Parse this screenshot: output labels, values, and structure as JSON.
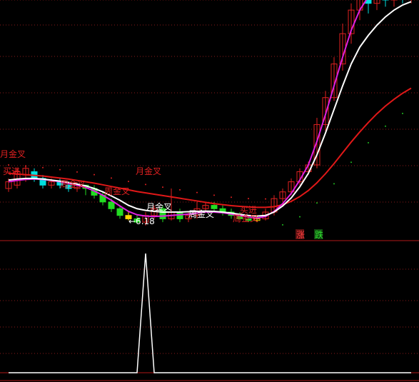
{
  "chart_data": {
    "type": "candlestick",
    "colors": {
      "background": "#000000",
      "grid": "#8a1a1a",
      "panel_border": "#b01818",
      "up": "#e02020",
      "down": "#00e0e0",
      "green_down": "#22dd22",
      "yellow": "#ffd700",
      "ma_white": "#ffffff",
      "ma_magenta": "#e020e0",
      "ma_red": "#e01818",
      "sar_dots": "#20c020",
      "sar_dots_red": "#e02020",
      "signal_red": "#e02020",
      "signal_white": "#ffffff",
      "price_label": "#ffffff"
    },
    "price_panel": {
      "ylim": [
        5.5,
        12.5
      ],
      "candles": [
        [
          6.9,
          7.1,
          6.8,
          7.2
        ],
        [
          7.0,
          7.4,
          6.9,
          7.5
        ],
        [
          7.3,
          7.5,
          7.1,
          7.6
        ],
        [
          7.4,
          7.2,
          7.1,
          7.5
        ],
        [
          7.2,
          7.0,
          6.9,
          7.3
        ],
        [
          7.0,
          7.1,
          6.9,
          7.2
        ],
        [
          7.1,
          7.0,
          6.9,
          7.2
        ],
        [
          7.0,
          6.9,
          6.8,
          7.1
        ],
        [
          6.9,
          7.0,
          6.8,
          7.1
        ],
        [
          7.0,
          6.9,
          6.7,
          7.0
        ],
        [
          6.9,
          6.7,
          6.6,
          7.0
        ],
        [
          6.7,
          6.5,
          6.4,
          6.8
        ],
        [
          6.5,
          6.3,
          6.2,
          6.6
        ],
        [
          6.3,
          6.1,
          6.0,
          6.4
        ],
        [
          6.1,
          6.0,
          5.95,
          6.2
        ],
        [
          6.0,
          5.9,
          5.85,
          6.1
        ],
        [
          5.9,
          6.1,
          5.8,
          6.2
        ],
        [
          6.1,
          6.3,
          6.0,
          6.4
        ],
        [
          6.3,
          6.0,
          5.9,
          6.4
        ],
        [
          6.0,
          6.2,
          5.95,
          6.9
        ],
        [
          6.2,
          6.0,
          5.9,
          6.3
        ],
        [
          6.0,
          6.1,
          5.9,
          6.2
        ],
        [
          6.1,
          6.3,
          6.0,
          6.5
        ],
        [
          6.3,
          6.4,
          6.2,
          6.5
        ],
        [
          6.4,
          6.3,
          6.2,
          6.5
        ],
        [
          6.3,
          6.2,
          6.1,
          6.4
        ],
        [
          6.2,
          6.1,
          6.0,
          6.3
        ],
        [
          6.1,
          6.0,
          5.95,
          6.2
        ],
        [
          6.0,
          5.95,
          5.9,
          6.1
        ],
        [
          5.95,
          6.0,
          5.9,
          6.1
        ],
        [
          6.0,
          6.2,
          5.95,
          6.3
        ],
        [
          6.2,
          6.6,
          6.1,
          6.7
        ],
        [
          6.6,
          6.8,
          6.5,
          6.9
        ],
        [
          6.8,
          7.1,
          6.7,
          7.2
        ],
        [
          7.1,
          7.4,
          7.0,
          7.5
        ],
        [
          7.4,
          7.6,
          7.3,
          7.7
        ],
        [
          7.6,
          8.8,
          7.5,
          9.0
        ],
        [
          8.8,
          9.6,
          8.6,
          9.8
        ],
        [
          9.6,
          10.6,
          9.5,
          10.8
        ],
        [
          10.6,
          11.5,
          10.4,
          11.8
        ],
        [
          11.5,
          12.2,
          11.2,
          12.4
        ],
        [
          12.2,
          12.6,
          11.9,
          12.8
        ],
        [
          12.6,
          12.4,
          12.1,
          12.9
        ],
        [
          12.4,
          12.7,
          12.2,
          12.9
        ],
        [
          12.7,
          12.5,
          12.3,
          12.8
        ],
        [
          12.5,
          12.8,
          12.3,
          12.9
        ],
        [
          12.8,
          12.6,
          12.4,
          12.9
        ],
        [
          12.6,
          12.7,
          12.4,
          12.8
        ]
      ],
      "ma_white": [
        7.15,
        7.18,
        7.2,
        7.2,
        7.18,
        7.15,
        7.12,
        7.08,
        7.03,
        6.98,
        6.9,
        6.8,
        6.68,
        6.55,
        6.4,
        6.3,
        6.25,
        6.22,
        6.2,
        6.2,
        6.2,
        6.21,
        6.22,
        6.23,
        6.22,
        6.2,
        6.17,
        6.13,
        6.1,
        6.08,
        6.1,
        6.2,
        6.38,
        6.62,
        6.95,
        7.35,
        7.9,
        8.55,
        9.25,
        9.95,
        10.6,
        11.1,
        11.45,
        11.75,
        12.0,
        12.2,
        12.35,
        12.45
      ],
      "ma_magenta": [
        7.1,
        7.14,
        7.17,
        7.18,
        7.17,
        7.14,
        7.1,
        7.05,
        7.0,
        6.93,
        6.83,
        6.7,
        6.55,
        6.38,
        6.22,
        6.12,
        6.08,
        6.07,
        6.08,
        6.1,
        6.12,
        6.14,
        6.17,
        6.2,
        6.2,
        6.18,
        6.14,
        6.1,
        6.05,
        6.02,
        6.07,
        6.22,
        6.45,
        6.75,
        7.15,
        7.6,
        8.3,
        9.1,
        9.95,
        10.8,
        11.6,
        12.2,
        12.6,
        12.9,
        13.1,
        13.2,
        13.3,
        13.3
      ],
      "ma_red": [
        7.35,
        7.33,
        7.31,
        7.29,
        7.27,
        7.24,
        7.21,
        7.18,
        7.14,
        7.1,
        7.06,
        7.01,
        6.96,
        6.91,
        6.86,
        6.81,
        6.77,
        6.73,
        6.69,
        6.65,
        6.61,
        6.57,
        6.53,
        6.49,
        6.45,
        6.42,
        6.39,
        6.37,
        6.35,
        6.34,
        6.34,
        6.36,
        6.42,
        6.52,
        6.66,
        6.84,
        7.07,
        7.34,
        7.64,
        7.96,
        8.28,
        8.58,
        8.86,
        9.12,
        9.35,
        9.55,
        9.73,
        9.88
      ]
    },
    "annotations": [
      {
        "text": "月金叉",
        "color": "red"
      },
      {
        "text": "买进",
        "color": "red"
      },
      {
        "text": "月金叉",
        "color": "red"
      },
      {
        "text": "周金叉",
        "color": "red"
      },
      {
        "text": "周金叉",
        "color": "red"
      },
      {
        "text": "月金叉",
        "color": "white"
      },
      {
        "text": "周金叉",
        "color": "white"
      },
      {
        "text": "买进",
        "color": "red"
      },
      {
        "text": "周金叉",
        "color": "red"
      },
      {
        "text": "←6.18",
        "color": "white"
      }
    ],
    "legend": [
      {
        "text": "涨",
        "color": "red"
      },
      {
        "text": "跌",
        "color": "green"
      }
    ],
    "signal_panel": {
      "ylim": [
        0,
        1
      ],
      "values": [
        0,
        0,
        0,
        0,
        0,
        0,
        0,
        0,
        0,
        0,
        0,
        0,
        0,
        0,
        0,
        0,
        1,
        0,
        0,
        0,
        0,
        0,
        0,
        0,
        0,
        0,
        0,
        0,
        0,
        0,
        0,
        0,
        0,
        0,
        0,
        0,
        0,
        0,
        0,
        0,
        0,
        0,
        0,
        0,
        0,
        0,
        0,
        0
      ]
    }
  }
}
